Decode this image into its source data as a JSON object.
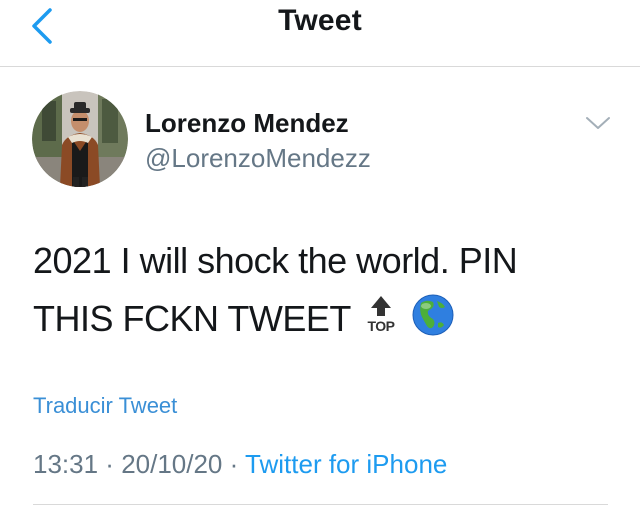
{
  "header": {
    "title": "Tweet"
  },
  "author": {
    "name": "Lorenzo Mendez",
    "handle": "@LorenzoMendezz"
  },
  "tweet": {
    "line1": "2021 I will shock the world. PIN",
    "line2": "THIS FCKN TWEET",
    "emojis": [
      "top-arrow-icon",
      "globe-americas-icon"
    ],
    "top_emoji_label": "TOP"
  },
  "translate_label": "Traducir Tweet",
  "meta": {
    "time": "13:31",
    "separator": " · ",
    "date": "20/10/20",
    "source": "Twitter for iPhone"
  },
  "colors": {
    "accent": "#1d9bf0",
    "secondary_text": "#657786"
  }
}
